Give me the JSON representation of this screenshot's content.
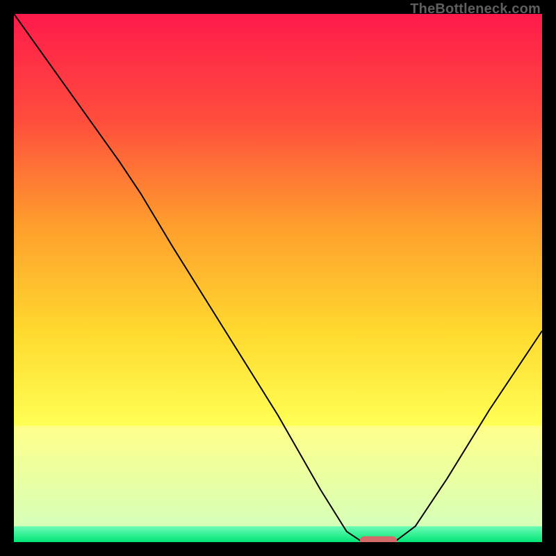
{
  "watermark": "TheBottleneck.com",
  "chart_data": {
    "type": "line",
    "title": "",
    "xlabel": "",
    "ylabel": "",
    "xlim": [
      0,
      100
    ],
    "ylim": [
      0,
      100
    ],
    "grid": false,
    "legend": false,
    "background_gradient_stops": [
      {
        "offset": 0.0,
        "color": "#ff1a4b"
      },
      {
        "offset": 0.2,
        "color": "#ff4d3d"
      },
      {
        "offset": 0.4,
        "color": "#ff9e2d"
      },
      {
        "offset": 0.6,
        "color": "#ffd92e"
      },
      {
        "offset": 0.78,
        "color": "#ffff55"
      },
      {
        "offset": 0.86,
        "color": "#fdffb0"
      },
      {
        "offset": 0.92,
        "color": "#d6ffb8"
      },
      {
        "offset": 0.965,
        "color": "#7fffc0"
      },
      {
        "offset": 1.0,
        "color": "#00e676"
      }
    ],
    "pale_band": {
      "y0": 78,
      "y1": 97,
      "color_top": "#ffff8a",
      "color_bottom": "#d6ffb8"
    },
    "curve": {
      "color": "#000000",
      "width": 2,
      "points": [
        {
          "x": 0,
          "y": 100
        },
        {
          "x": 10,
          "y": 86
        },
        {
          "x": 20,
          "y": 72
        },
        {
          "x": 24,
          "y": 66
        },
        {
          "x": 30,
          "y": 56
        },
        {
          "x": 40,
          "y": 40
        },
        {
          "x": 50,
          "y": 24
        },
        {
          "x": 58,
          "y": 10
        },
        {
          "x": 63,
          "y": 2
        },
        {
          "x": 66,
          "y": 0
        },
        {
          "x": 72,
          "y": 0
        },
        {
          "x": 76,
          "y": 3
        },
        {
          "x": 82,
          "y": 12
        },
        {
          "x": 90,
          "y": 25
        },
        {
          "x": 100,
          "y": 40
        }
      ]
    },
    "marker": {
      "shape": "rounded-rect",
      "x_center": 69,
      "y": 0,
      "width": 7,
      "height": 2.2,
      "fill": "#d46a6a"
    }
  }
}
